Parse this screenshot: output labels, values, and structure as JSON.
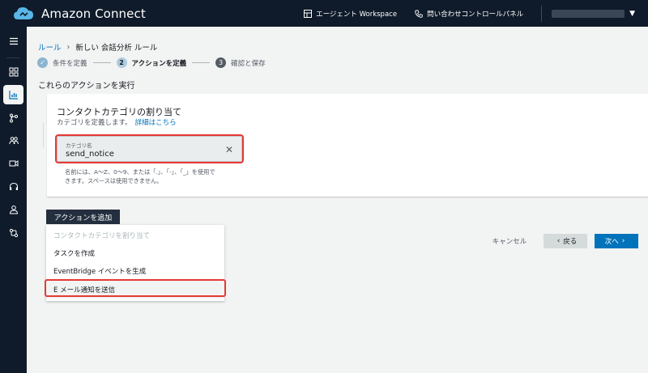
{
  "header": {
    "app_title": "Amazon Connect",
    "workspace_link": "エージェント Workspace",
    "control_panel_link": "問い合わせコントロールパネル"
  },
  "breadcrumb": {
    "root": "ルール",
    "current": "新しい 会話分析 ルール"
  },
  "steps": [
    {
      "number": "1",
      "label": "条件を定義",
      "state": "done"
    },
    {
      "number": "2",
      "label": "アクションを定義",
      "state": "current"
    },
    {
      "number": "3",
      "label": "確認と保存",
      "state": "upcoming"
    }
  ],
  "section_title": "これらのアクションを実行",
  "card": {
    "title": "コンタクトカテゴリの割り当て",
    "description": "カテゴリを定義します。",
    "more_link": "詳細はこちら",
    "field_label": "カテゴリ名",
    "field_value": "send_notice",
    "help_line1": "名前には、A～Z、0～9、または「.」、「-」、「_」を使用で",
    "help_line2": "きます。スペースは使用できません。"
  },
  "add_action_button": "アクションを追加",
  "dropdown_items": [
    {
      "label": "コンタクトカテゴリを割り当て",
      "disabled": true
    },
    {
      "label": "タスクを作成",
      "disabled": false
    },
    {
      "label": "EventBridge イベントを生成",
      "disabled": false
    },
    {
      "label": "E メール通知を送信",
      "disabled": false
    }
  ],
  "footer": {
    "cancel": "キャンセル",
    "back": "戻る",
    "next": "次へ"
  },
  "colors": {
    "topbar": "#0f1b2a",
    "primary": "#0073bb",
    "highlight": "#e53935"
  }
}
